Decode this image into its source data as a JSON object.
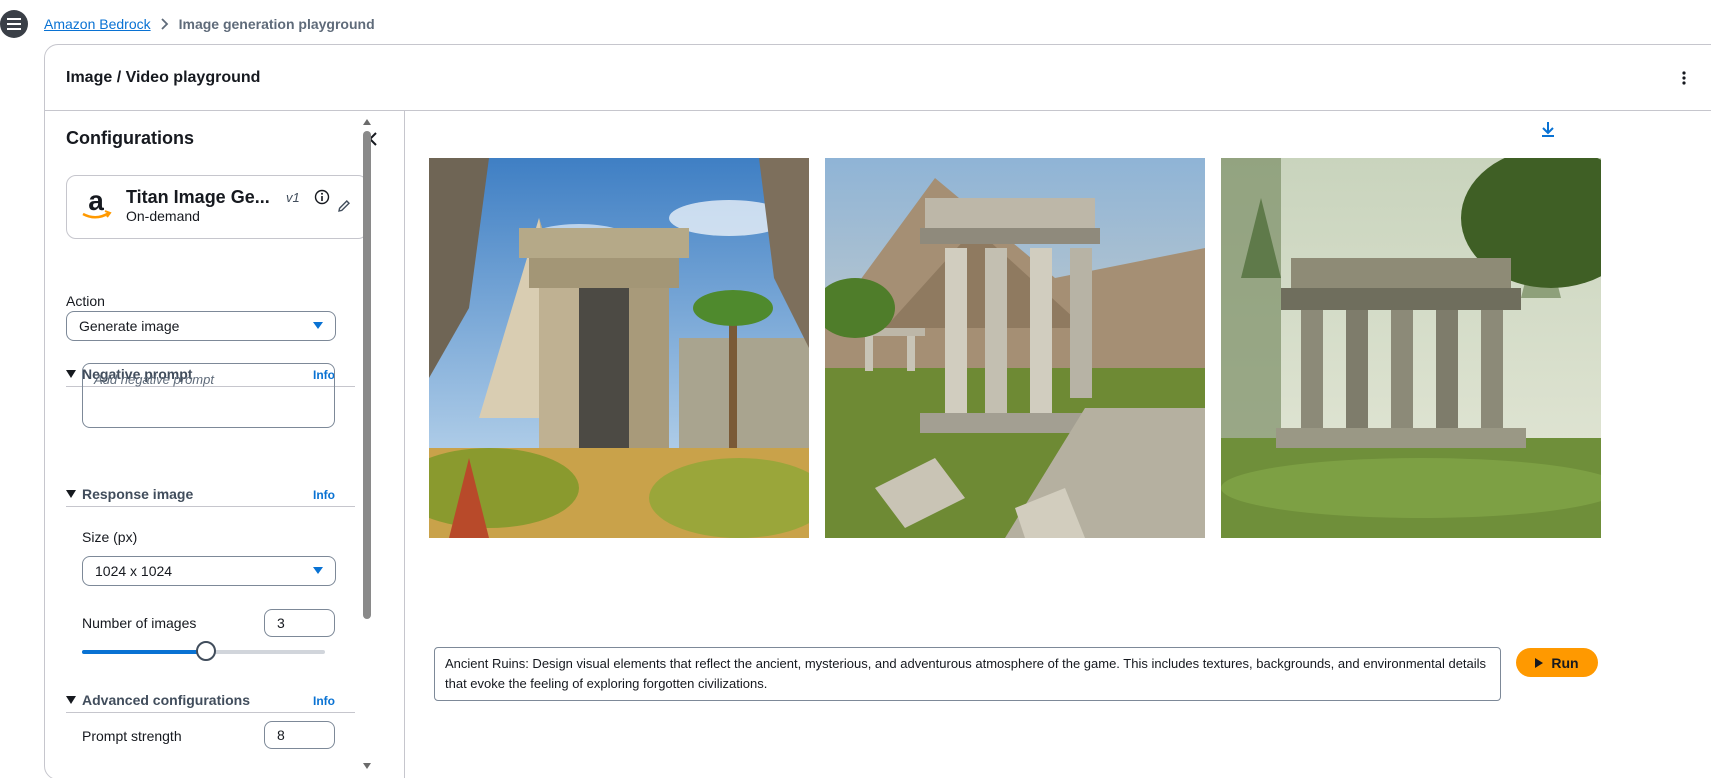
{
  "nav": {
    "menu_icon": "hamburger-icon",
    "breadcrumb": [
      {
        "label": "Amazon Bedrock"
      },
      {
        "label": "Image generation playground"
      }
    ]
  },
  "page": {
    "title": "Image / Video playground",
    "more_icon": "vertical-ellipsis-icon"
  },
  "config": {
    "title": "Configurations",
    "collapse_icon": "chevron-left-icon",
    "model": {
      "logo": "amazon-logo",
      "name": "Titan Image Ge...",
      "version": "v1",
      "mode": "On-demand"
    },
    "action": {
      "label": "Action",
      "value": "Generate image"
    },
    "negative_prompt": {
      "title": "Negative prompt",
      "info": "Info",
      "placeholder": "Add negative prompt"
    },
    "response_image": {
      "title": "Response image",
      "info": "Info",
      "size_label": "Size (px)",
      "size_value": "1024 x 1024",
      "count_label": "Number of images",
      "count_value": "3",
      "count_slider_fraction": 0.51
    },
    "advanced": {
      "title": "Advanced configurations",
      "info": "Info",
      "strength_label": "Prompt strength",
      "strength_value": "8"
    }
  },
  "output": {
    "download_icon": "download-icon",
    "images": [
      {
        "alt": "Ancient Ruins image 1"
      },
      {
        "alt": "Ancient Ruins image 2"
      },
      {
        "alt": "Ancient Ruins image 3"
      }
    ],
    "prompt": "Ancient Ruins: Design visual elements that reflect the ancient, mysterious, and adventurous atmosphere of the game. This includes textures, backgrounds, and environmental details that evoke the feeling of exploring forgotten civilizations.",
    "run_label": "Run"
  },
  "colors": {
    "accent": "#0972d3",
    "run_button": "#ff9900",
    "border": "#c6c6cd"
  }
}
